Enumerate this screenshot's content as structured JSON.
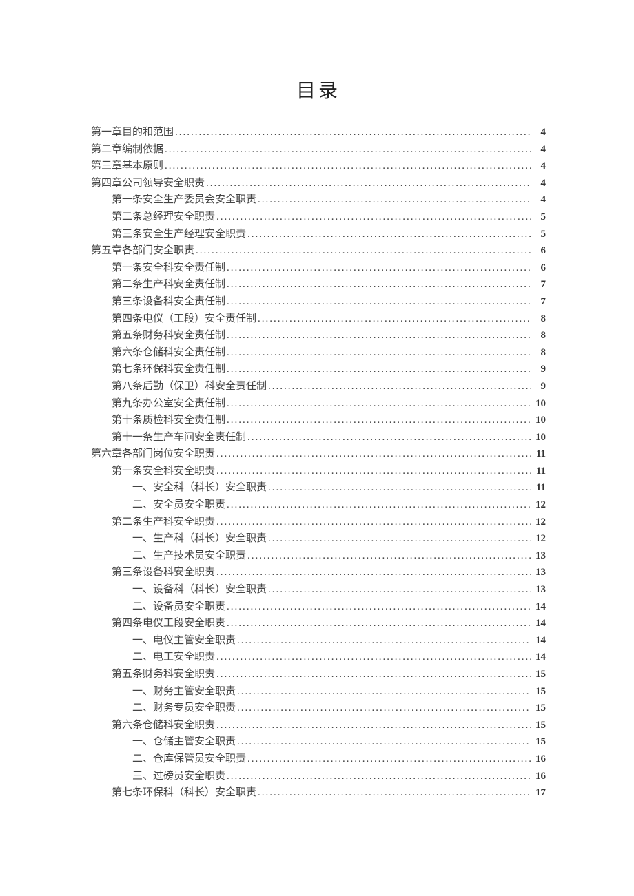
{
  "title": "目录",
  "toc": [
    {
      "indent": 0,
      "label": "第一章目的和范围",
      "page": "4"
    },
    {
      "indent": 0,
      "label": "第二章编制依据",
      "page": "4"
    },
    {
      "indent": 0,
      "label": "第三章基本原则",
      "page": "4"
    },
    {
      "indent": 0,
      "label": "第四章公司领导安全职责",
      "page": "4"
    },
    {
      "indent": 1,
      "label": "第一条安全生产委员会安全职责",
      "page": "4"
    },
    {
      "indent": 1,
      "label": "第二条总经理安全职责",
      "page": "5"
    },
    {
      "indent": 1,
      "label": "第三条安全生产经理安全职责",
      "page": "5"
    },
    {
      "indent": 0,
      "label": "第五章各部门安全职责",
      "page": "6"
    },
    {
      "indent": 1,
      "label": "第一条安全科安全责任制",
      "page": "6"
    },
    {
      "indent": 1,
      "label": "第二条生产科安全责任制",
      "page": "7"
    },
    {
      "indent": 1,
      "label": "第三条设备科安全责任制",
      "page": "7"
    },
    {
      "indent": 1,
      "label": "第四条电仪（工段）安全责任制",
      "page": "8"
    },
    {
      "indent": 1,
      "label": "第五条财务科安全责任制",
      "page": "8"
    },
    {
      "indent": 1,
      "label": "第六条仓储科安全责任制",
      "page": "8"
    },
    {
      "indent": 1,
      "label": "第七条环保科安全责任制",
      "page": "9"
    },
    {
      "indent": 1,
      "label": "第八条后勤（保卫）科安全责任制",
      "page": "9"
    },
    {
      "indent": 1,
      "label": "第九条办公室安全责任制",
      "page": "10"
    },
    {
      "indent": 1,
      "label": "第十条质检科安全责任制",
      "page": "10"
    },
    {
      "indent": 1,
      "label": "第十一条生产车间安全责任制",
      "page": "10"
    },
    {
      "indent": 0,
      "label": "第六章各部门岗位安全职责",
      "page": "11"
    },
    {
      "indent": 1,
      "label": "第一条安全科安全职责",
      "page": "11"
    },
    {
      "indent": 2,
      "label": "一、安全科（科长）安全职责",
      "page": "11"
    },
    {
      "indent": 2,
      "label": "二、安全员安全职责",
      "page": "12"
    },
    {
      "indent": 1,
      "label": "第二条生产科安全职责",
      "page": "12"
    },
    {
      "indent": 2,
      "label": "一、生产科（科长）安全职责",
      "page": "12"
    },
    {
      "indent": 2,
      "label": "二、生产技术员安全职责",
      "page": "13"
    },
    {
      "indent": 1,
      "label": "第三条设备科安全职责",
      "page": "13"
    },
    {
      "indent": 2,
      "label": "一、设备科（科长）安全职责",
      "page": "13"
    },
    {
      "indent": 2,
      "label": "二、设备员安全职责",
      "page": "14"
    },
    {
      "indent": 1,
      "label": "第四条电仪工段安全职责",
      "page": "14"
    },
    {
      "indent": 2,
      "label": "一、电仪主管安全职责",
      "page": "14"
    },
    {
      "indent": 2,
      "label": "二、电工安全职责",
      "page": "14"
    },
    {
      "indent": 1,
      "label": "第五条财务科安全职责",
      "page": "15"
    },
    {
      "indent": 2,
      "label": "一、财务主管安全职责",
      "page": "15"
    },
    {
      "indent": 2,
      "label": "二、财务专员安全职责",
      "page": "15"
    },
    {
      "indent": 1,
      "label": "第六条仓储科安全职责",
      "page": "15"
    },
    {
      "indent": 2,
      "label": "一、仓储主管安全职责",
      "page": "15"
    },
    {
      "indent": 2,
      "label": "二、仓库保管员安全职责",
      "page": "16"
    },
    {
      "indent": 2,
      "label": "三、过磅员安全职责",
      "page": "16"
    },
    {
      "indent": 1,
      "label": "第七条环保科（科长）安全职责",
      "page": "17"
    }
  ]
}
